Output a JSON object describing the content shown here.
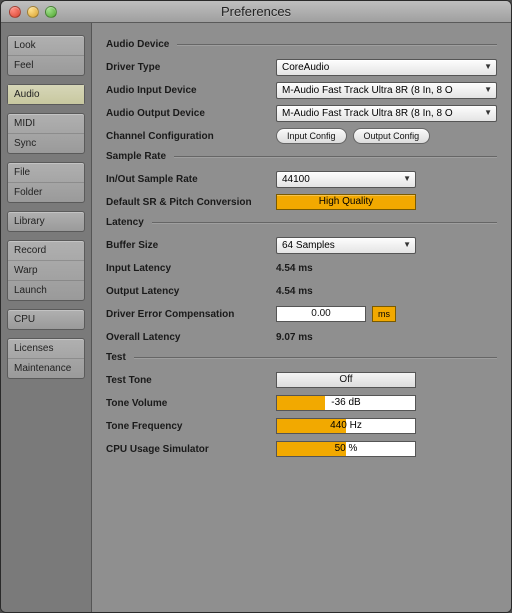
{
  "window": {
    "title": "Preferences"
  },
  "sidebar": {
    "groups": [
      [
        "Look",
        "Feel"
      ],
      [
        "Audio"
      ],
      [
        "MIDI",
        "Sync"
      ],
      [
        "File",
        "Folder"
      ],
      [
        "Library"
      ],
      [
        "Record",
        "Warp",
        "Launch"
      ],
      [
        "CPU"
      ],
      [
        "Licenses",
        "Maintenance"
      ]
    ]
  },
  "sections": {
    "audio_device": {
      "title": "Audio Device",
      "driver_type_label": "Driver Type",
      "driver_type_value": "CoreAudio",
      "input_device_label": "Audio Input Device",
      "input_device_value": "M-Audio Fast Track Ultra 8R (8 In, 8 O",
      "output_device_label": "Audio Output Device",
      "output_device_value": "M-Audio Fast Track Ultra 8R (8 In, 8 O",
      "channel_config_label": "Channel Configuration",
      "input_config_btn": "Input Config",
      "output_config_btn": "Output Config"
    },
    "sample_rate": {
      "title": "Sample Rate",
      "inout_label": "In/Out Sample Rate",
      "inout_value": "44100",
      "default_label": "Default SR & Pitch Conversion",
      "default_value": "High Quality"
    },
    "latency": {
      "title": "Latency",
      "buffer_label": "Buffer Size",
      "buffer_value": "64 Samples",
      "input_lat_label": "Input Latency",
      "input_lat_value": "4.54 ms",
      "output_lat_label": "Output Latency",
      "output_lat_value": "4.54 ms",
      "comp_label": "Driver Error Compensation",
      "comp_value": "0.00",
      "comp_unit": "ms",
      "overall_label": "Overall Latency",
      "overall_value": "9.07 ms"
    },
    "test": {
      "title": "Test",
      "tone_label": "Test Tone",
      "tone_value": "Off",
      "vol_label": "Tone Volume",
      "vol_value": "-36 dB",
      "vol_fill": "35%",
      "freq_label": "Tone Frequency",
      "freq_value": "440 Hz",
      "freq_fill": "50%",
      "cpu_label": "CPU Usage Simulator",
      "cpu_value": "50 %",
      "cpu_fill": "50%"
    }
  }
}
